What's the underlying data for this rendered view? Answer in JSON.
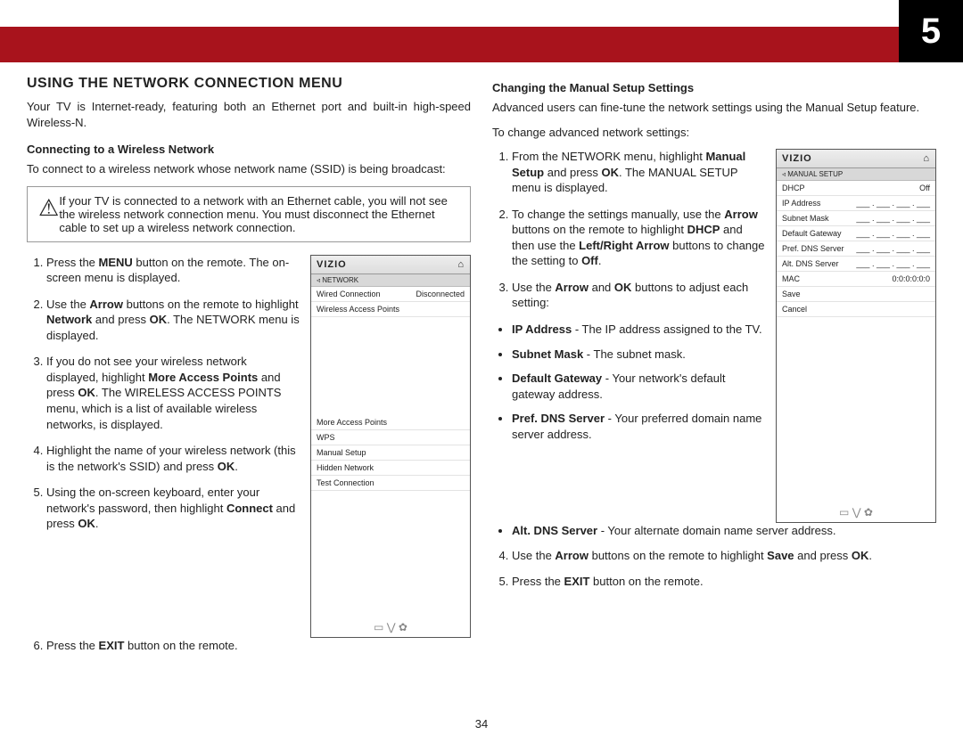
{
  "header": {
    "page_number": "5"
  },
  "left": {
    "title": "USING THE NETWORK CONNECTION MENU",
    "intro": "Your TV is Internet-ready, featuring both an Ethernet port and built-in high-speed Wireless-N.",
    "sub1": "Connecting to a Wireless Network",
    "sub1_intro": "To connect to a wireless network whose network name (SSID) is being broadcast:",
    "callout": "If your TV is connected to a network with an Ethernet cable, you will not see the wireless network connection menu. You must disconnect the Ethernet cable to set up a wireless network connection.",
    "steps": [
      "Press the <b>MENU</b> button on the remote. The on-screen menu is displayed.",
      "Use the <b>Arrow</b> buttons on the remote to highlight <b>Network</b> and press <b>OK</b>. The NETWORK menu is displayed.",
      "If you do not see your wireless network displayed, highlight <b>More Access Points</b> and press <b>OK</b>. The WIRELESS ACCESS POINTS menu, which is a list of available wireless networks, is displayed.",
      "Highlight the name of your wireless network (this is the network's SSID) and press <b>OK</b>.",
      "Using the on-screen keyboard, enter your network's password, then highlight <b>Connect</b> and press <b>OK</b>.",
      "Press the <b>EXIT</b> button on the remote."
    ],
    "vizio": {
      "brand": "VIZIO",
      "home_icon": "⌂",
      "crumb": "◃ NETWORK",
      "rows_top": [
        {
          "l": "Wired Connection",
          "r": "Disconnected"
        },
        {
          "l": "Wireless Access Points",
          "r": ""
        }
      ],
      "rows_bottom": [
        "More Access Points",
        "WPS",
        "Manual Setup",
        "Hidden Network",
        "Test Connection"
      ],
      "footer": "▭  ⋁  ✿"
    }
  },
  "right": {
    "sub2": "Changing the Manual Setup Settings",
    "sub2_intro1": "Advanced users can fine-tune the network settings using the Manual Setup feature.",
    "sub2_intro2": "To change advanced network settings:",
    "steps": [
      "From the NETWORK menu, highlight <b>Manual Setup</b> and press <b>OK</b>. The MANUAL SETUP menu is displayed.",
      "To change the settings manually, use the <b>Arrow</b> buttons on the remote to highlight <b>DHCP</b> and then use the <b>Left/Right Arrow</b> buttons to change the setting to <b>Off</b>.",
      "Use the <b>Arrow</b> and <b>OK</b> buttons to adjust each setting:"
    ],
    "bullets": [
      "<b>IP Address</b> - The IP address assigned to the TV.",
      "<b>Subnet Mask</b> - The subnet mask.",
      "<b>Default Gateway</b> - Your network's default gateway address.",
      "<b>Pref. DNS Server</b> - Your preferred domain name server address.",
      "<b>Alt. DNS Server</b> - Your alternate domain name server address."
    ],
    "steps_after": [
      "Use the <b>Arrow</b> buttons on the remote to highlight <b>Save</b> and press <b>OK</b>.",
      "Press the <b>EXIT</b> button on the remote."
    ],
    "vizio": {
      "brand": "VIZIO",
      "home_icon": "⌂",
      "crumb": "◃ MANUAL SETUP",
      "rows": [
        {
          "l": "DHCP",
          "r": "Off"
        },
        {
          "l": "IP Address",
          "r": "___ . ___ . ___ . ___"
        },
        {
          "l": "Subnet Mask",
          "r": "___ . ___ . ___ . ___"
        },
        {
          "l": "Default Gateway",
          "r": "___ . ___ . ___ . ___"
        },
        {
          "l": "Pref. DNS Server",
          "r": "___ . ___ . ___ . ___"
        },
        {
          "l": "Alt. DNS Server",
          "r": "___ . ___ . ___ . ___"
        },
        {
          "l": "MAC",
          "r": "0:0:0:0:0:0"
        },
        {
          "l": "Save",
          "r": ""
        },
        {
          "l": "Cancel",
          "r": ""
        }
      ],
      "footer": "▭  ⋁  ✿"
    }
  },
  "footer_page": "34"
}
